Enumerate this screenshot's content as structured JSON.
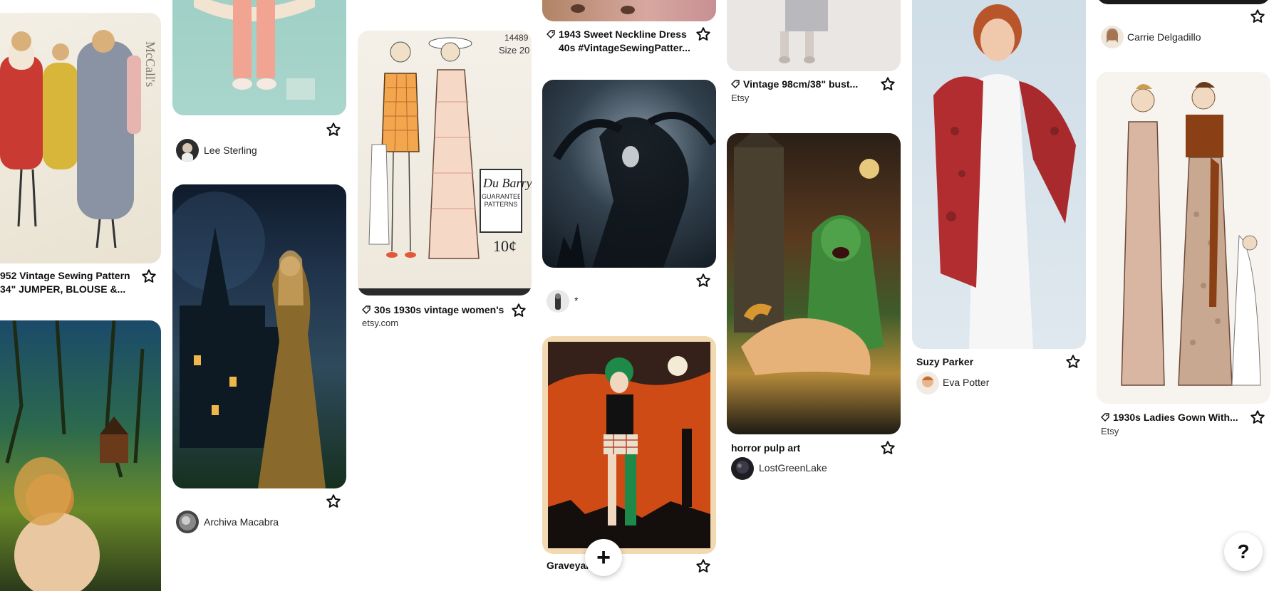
{
  "pins": {
    "p1": {
      "title_line1": "952 Vintage Sewing Pattern",
      "title_line2": "34\" JUMPER, BLOUSE &...",
      "pattern_brand": "McCall's"
    },
    "p2": {
      "creator": "Lee Sterling"
    },
    "p3": {
      "creator": "Archiva Macabra"
    },
    "p4": {
      "title": "30s 1930s vintage women's...",
      "source": "etsy.com",
      "pattern_number": "14489",
      "size_text": "Size 20",
      "brand_text": "Du Barry",
      "brand_sub": "GUARANTEED PATTERNS",
      "price_text": "10¢"
    },
    "p5": {
      "title_line1": "1943 Sweet Neckline Dress",
      "title_line2": "40s #VintageSewingPatter..."
    },
    "p6": {
      "creator": "*"
    },
    "p7": {
      "title": "Graveyar..."
    },
    "p8": {
      "title": "Vintage 98cm/38\" bust...",
      "source": "Etsy"
    },
    "p9": {
      "title": "horror pulp art",
      "creator": "LostGreenLake"
    },
    "p10": {
      "title": "Suzy Parker",
      "creator": "Eva Potter"
    },
    "p11": {
      "creator": "Carrie Delgadillo"
    },
    "p12": {
      "title": "1930s Ladies Gown With...",
      "source": "Etsy"
    }
  },
  "controls": {
    "add_symbol": "+",
    "help_symbol": "?"
  },
  "icons": {
    "save": "star-outline-icon",
    "tag": "price-tag-icon",
    "add": "plus-icon",
    "help": "question-mark-icon"
  }
}
